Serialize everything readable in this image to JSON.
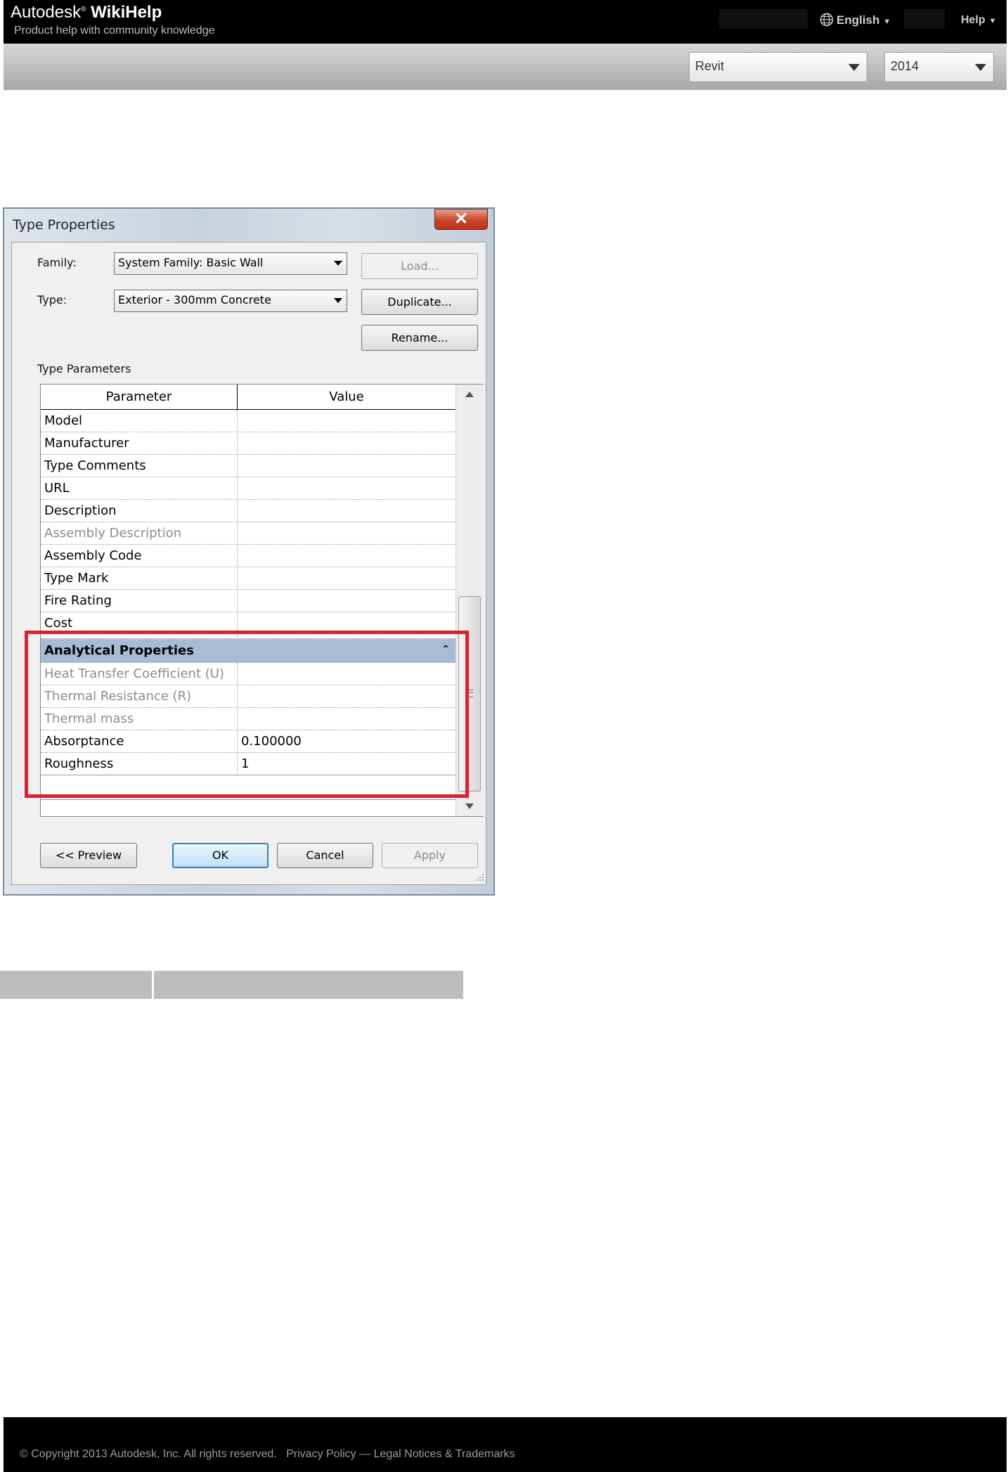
{
  "site": {
    "brand_plain": "Autodesk",
    "brand_reg": "®",
    "brand_bold": "WikiHelp",
    "tagline": "Product help with community knowledge",
    "language_label": "English",
    "help_label": "Help"
  },
  "toolbar": {
    "product_select": "Revit",
    "version_select": "2014"
  },
  "dialog": {
    "title": "Type Properties",
    "close_glyph": "✕",
    "family_label": "Family:",
    "family_value": "System Family: Basic Wall",
    "type_label": "Type:",
    "type_value": "Exterior - 300mm Concrete",
    "load_button": "Load...",
    "duplicate_button": "Duplicate...",
    "rename_button": "Rename...",
    "type_parameters_label": "Type Parameters",
    "columns": {
      "parameter": "Parameter",
      "value": "Value"
    },
    "rows": [
      {
        "parameter": "Model",
        "value": ""
      },
      {
        "parameter": "Manufacturer",
        "value": ""
      },
      {
        "parameter": "Type Comments",
        "value": ""
      },
      {
        "parameter": "URL",
        "value": ""
      },
      {
        "parameter": "Description",
        "value": ""
      },
      {
        "parameter": "Assembly Description",
        "value": ""
      },
      {
        "parameter": "Assembly Code",
        "value": ""
      },
      {
        "parameter": "Type Mark",
        "value": ""
      },
      {
        "parameter": "Fire Rating",
        "value": ""
      },
      {
        "parameter": "Cost",
        "value": ""
      }
    ],
    "group": {
      "title": "Analytical Properties",
      "collapse_glyph": "⌃",
      "rows": [
        {
          "parameter": "Heat Transfer Coefficient (U)",
          "value": ""
        },
        {
          "parameter": "Thermal Resistance (R)",
          "value": ""
        },
        {
          "parameter": "Thermal mass",
          "value": ""
        },
        {
          "parameter": "Absorptance",
          "value": "0.100000"
        },
        {
          "parameter": "Roughness",
          "value": "1"
        }
      ]
    },
    "preview_button": "<< Preview",
    "ok_button": "OK",
    "cancel_button": "Cancel",
    "apply_button": "Apply"
  },
  "footer": {
    "text": "© Copyright 2013 Autodesk, Inc. All rights reserved.   Privacy Policy — Legal Notices & Trademarks"
  },
  "colors": {
    "header_bg": "#000000",
    "highlight": "#e0202f",
    "group_row": "#a7bbd4",
    "default_button_border": "#3c7fb1"
  }
}
